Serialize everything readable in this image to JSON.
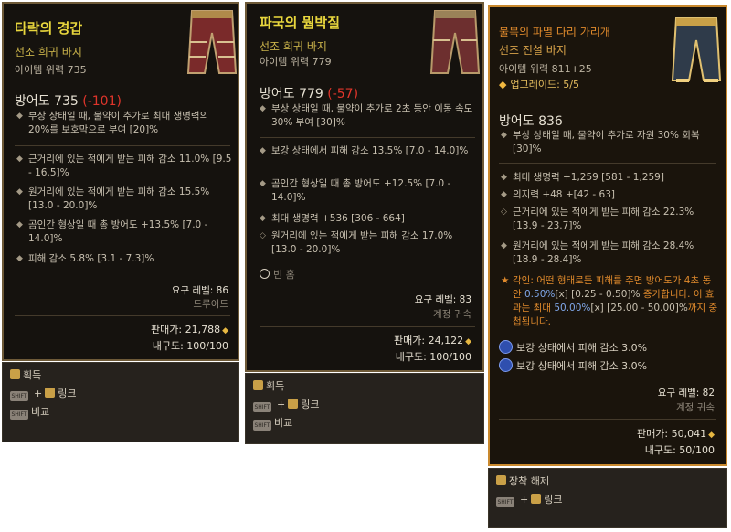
{
  "tooltips": [
    {
      "name": "타락의 경갑",
      "rarity_line": "선조 희귀 바지",
      "item_power": "아이템 위력 735",
      "armor_label": "방어도 735",
      "armor_diff": "(-101)",
      "implicit": [
        "부상 상태일 때, 물약이 추가로 최대 생명력의 20%를 보호막으로 부여 [20]%"
      ],
      "affixes": [
        "근거리에 있는 적에게 받는 피해 감소 11.0% [9.5 - 16.5]%",
        "원거리에 있는 적에게 받는 피해 감소 15.5% [13.0 - 20.0]%",
        "곰인간 형상일 때 총 방어도 +13.5% [7.0 - 14.0]%",
        "피해 감소 5.8% [3.1 - 7.3]%"
      ],
      "required_level": "요구 레벨: 86",
      "class": "드루이드",
      "sell_value": "판매가: 21,788",
      "durability": "내구도: 100/100",
      "footer": [
        {
          "type": "action",
          "label": "획득"
        },
        {
          "type": "combo",
          "key": "SHIFT",
          "label": "링크"
        },
        {
          "type": "single",
          "key": "SHIFT",
          "label": "비교"
        }
      ]
    },
    {
      "name": "파국의 뭠박질",
      "rarity_line": "선조 희귀 바지",
      "item_power": "아이템 위력 779",
      "armor_label": "방어도 779",
      "armor_diff": "(-57)",
      "implicit": [
        "부상 상태일 때, 물약이 추가로 2초 동안 이동 속도 30% 부여 [30]%"
      ],
      "affixes": [
        "보강 상태에서 피해 감소 13.5% [7.0 - 14.0]%",
        "곰인간 형상일 때 총 방어도 +12.5% [7.0 - 14.0]%",
        "최대 생명력 +536 [306 - 664]",
        "원거리에 있는 적에게 받는 피해 감소 17.0% [13.0 - 20.0]%"
      ],
      "empty_socket": "빈 홈",
      "required_level": "요구 레벨: 83",
      "class": "계정 귀속",
      "sell_value": "판매가: 24,122",
      "durability": "내구도: 100/100",
      "footer": [
        {
          "type": "action",
          "label": "획득"
        },
        {
          "type": "combo",
          "key": "SHIFT",
          "label": "링크"
        },
        {
          "type": "single",
          "key": "SHIFT",
          "label": "비교"
        }
      ]
    },
    {
      "name": "불복의 파멸 다리 가리개",
      "rarity_line": "선조 전설 바지",
      "item_power": "아이템 위력 811+25",
      "upgrade": "업그레이드: 5/5",
      "armor_label": "방어도 836",
      "implicit": [
        "부상 상태일 때, 물약이 추가로 자원 30% 회복 [30]%"
      ],
      "affixes": [
        "최대 생명력 +1,259 [581 - 1,259]",
        "의지력 +48 +[42 - 63]",
        "근거리에 있는 적에게 받는 피해 감소 22.3% [13.9 - 23.7]%",
        "원거리에 있는 적에게 받는 피해 감소 28.4% [18.9 - 28.4]%"
      ],
      "aspect_prefix": "각인: 어떤 형태로든 피해를 주면 방어도가 4초 동안 ",
      "aspect_val1": "0.50%",
      "aspect_rng1": "[x] [0.25 - 0.50]%",
      "aspect_mid": " 증가합니다. 이 효과는 최대 ",
      "aspect_val2": "50.00%",
      "aspect_rng2": "[x] [25.00 - 50.00]%",
      "aspect_suffix": "까지 중첩됩니다.",
      "gems": [
        "보강 상태에서 피해 감소 3.0%",
        "보강 상태에서 피해 감소 3.0%"
      ],
      "required_level": "요구 레벨: 82",
      "class": "계정 귀속",
      "sell_value": "판매가: 50,041",
      "durability": "내구도: 50/100",
      "footer": [
        {
          "type": "action",
          "label": "장착 해제"
        },
        {
          "type": "combo",
          "key": "SHIFT",
          "label": "링크"
        }
      ]
    }
  ]
}
